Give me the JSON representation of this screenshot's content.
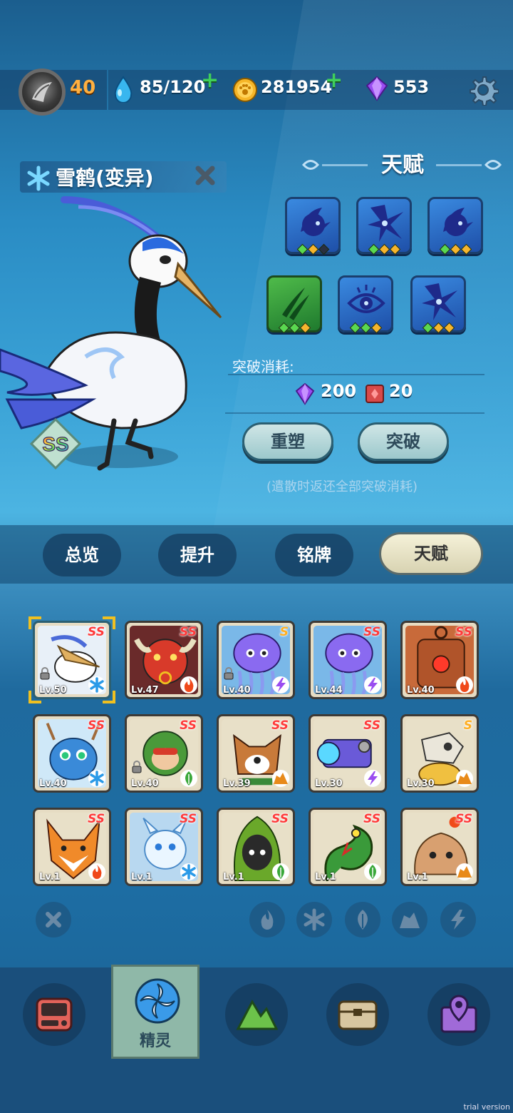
{
  "topbar": {
    "level": "40",
    "energy": "85/120",
    "coins": "281954",
    "gems": "553"
  },
  "pet": {
    "name": "雪鹤(变异)",
    "rank": "SS",
    "element_icon": "snowflake-icon"
  },
  "talent": {
    "title": "天赋",
    "skills_row1": [
      {
        "icon": "fin-icon",
        "dots": [
          "g",
          "o",
          "k"
        ]
      },
      {
        "icon": "star-burst-icon",
        "dots": [
          "g",
          "o",
          "o"
        ]
      },
      {
        "icon": "fin-icon",
        "dots": [
          "g",
          "o",
          "o"
        ]
      }
    ],
    "skills_row2": [
      {
        "icon": "claw-icon",
        "dots": [
          "g",
          "g",
          "o"
        ]
      },
      {
        "icon": "eye-icon",
        "dots": [
          "g",
          "g",
          "o"
        ]
      },
      {
        "icon": "star-burst-icon",
        "dots": [
          "g",
          "o",
          "o"
        ]
      }
    ],
    "cost_label": "突破消耗:",
    "cost_gems": "200",
    "cost_books": "20",
    "reshape": "重塑",
    "breakthrough": "突破",
    "note": "(遣散时返还全部突破消耗)"
  },
  "tabs": [
    "总览",
    "提升",
    "铭牌",
    "天赋"
  ],
  "active_tab": "天赋",
  "pets": [
    {
      "lv": "Lv.50",
      "rank": "SS",
      "element": "ice",
      "creature": "crane",
      "locked": true,
      "selected": true
    },
    {
      "lv": "Lv.47",
      "rank": "SS",
      "element": "fire",
      "creature": "bull"
    },
    {
      "lv": "Lv.40",
      "rank": "S",
      "element": "thunder",
      "creature": "jellyfish",
      "locked": true
    },
    {
      "lv": "Lv.44",
      "rank": "SS",
      "element": "thunder",
      "creature": "jellyfish"
    },
    {
      "lv": "Lv.40",
      "rank": "SS",
      "element": "fire",
      "creature": "robot"
    },
    {
      "lv": "Lv.40",
      "rank": "SS",
      "element": "ice",
      "creature": "deer"
    },
    {
      "lv": "Lv.40",
      "rank": "SS",
      "element": "grass",
      "creature": "monkey",
      "locked": true
    },
    {
      "lv": "Lv.39",
      "rank": "SS",
      "element": "rock",
      "creature": "dog"
    },
    {
      "lv": "Lv.30",
      "rank": "SS",
      "element": "thunder",
      "creature": "cannon"
    },
    {
      "lv": "Lv.30",
      "rank": "S",
      "element": "rock",
      "creature": "skull"
    },
    {
      "lv": "Lv.1",
      "rank": "SS",
      "element": "fire",
      "creature": "fox"
    },
    {
      "lv": "Lv.1",
      "rank": "SS",
      "element": "ice",
      "creature": "sprite"
    },
    {
      "lv": "Lv.1",
      "rank": "SS",
      "element": "grass",
      "creature": "hood"
    },
    {
      "lv": "Lv.1",
      "rank": "SS",
      "element": "grass",
      "creature": "snake"
    },
    {
      "lv": "Lv.1",
      "rank": "SS",
      "element": "rock",
      "creature": "blob"
    }
  ],
  "filters": [
    "fire-filter-icon",
    "ice-filter-icon",
    "grass-filter-icon",
    "rock-filter-icon",
    "thunder-filter-icon"
  ],
  "nav": {
    "items": [
      "device-icon",
      "spirit-icon",
      "mountain-icon",
      "chest-icon",
      "map-pin-icon"
    ],
    "active_label": "精灵"
  },
  "watermark": "trial version",
  "colors": {
    "accent_gold": "#ffb040",
    "plus_green": "#3fd05a",
    "rank_red": "#ff3a3a",
    "active_tab": "#f5f1d8"
  }
}
